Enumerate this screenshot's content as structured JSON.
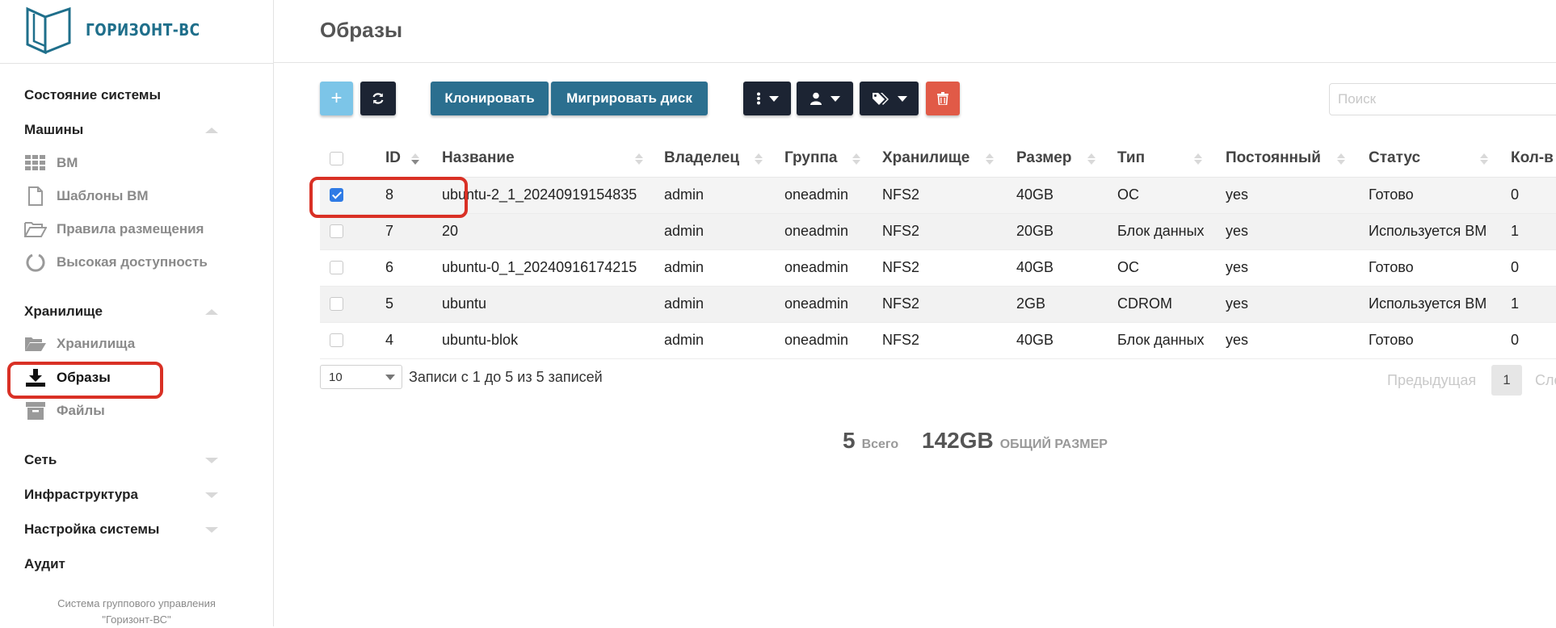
{
  "brand": {
    "name": "ГОРИЗОНТ-ВС"
  },
  "sidebar": {
    "system_state": "Состояние системы",
    "machines": {
      "label": "Машины",
      "items": [
        {
          "label": "ВМ",
          "icon": "grid-icon"
        },
        {
          "label": "Шаблоны ВМ",
          "icon": "file-icon"
        },
        {
          "label": "Правила размещения",
          "icon": "folder-open-icon"
        },
        {
          "label": "Высокая доступность",
          "icon": "circle-arc-icon"
        }
      ]
    },
    "storage": {
      "label": "Хранилище",
      "items": [
        {
          "label": "Хранилища",
          "icon": "folder-open-icon"
        },
        {
          "label": "Образы",
          "icon": "download-icon"
        },
        {
          "label": "Файлы",
          "icon": "archive-icon"
        }
      ]
    },
    "network": "Сеть",
    "infrastructure": "Инфраструктура",
    "settings": "Настройка системы",
    "audit": "Аудит",
    "footer_line1": "Система группового управления",
    "footer_line2": "\"Горизонт-ВС\""
  },
  "page": {
    "title": "Образы"
  },
  "toolbar": {
    "add_label": "+",
    "clone_label": "Клонировать",
    "migrate_label": "Мигрировать диск",
    "search_placeholder": "Поиск"
  },
  "table": {
    "columns": [
      "ID",
      "Название",
      "Владелец",
      "Группа",
      "Хранилище",
      "Размер",
      "Тип",
      "Постоянный",
      "Статус",
      "Кол-в"
    ],
    "rows": [
      {
        "checked": true,
        "id": "8",
        "name": "ubuntu-2_1_20240919154835",
        "owner": "admin",
        "group": "oneadmin",
        "datastore": "NFS2",
        "size": "40GB",
        "type": "ОС",
        "persistent": "yes",
        "status": "Готово",
        "count": "0"
      },
      {
        "checked": false,
        "id": "7",
        "name": "20",
        "owner": "admin",
        "group": "oneadmin",
        "datastore": "NFS2",
        "size": "20GB",
        "type": "Блок данных",
        "persistent": "yes",
        "status": "Используется ВМ",
        "count": "1"
      },
      {
        "checked": false,
        "id": "6",
        "name": "ubuntu-0_1_20240916174215",
        "owner": "admin",
        "group": "oneadmin",
        "datastore": "NFS2",
        "size": "40GB",
        "type": "ОС",
        "persistent": "yes",
        "status": "Готово",
        "count": "0"
      },
      {
        "checked": false,
        "id": "5",
        "name": "ubuntu",
        "owner": "admin",
        "group": "oneadmin",
        "datastore": "NFS2",
        "size": "2GB",
        "type": "CDROM",
        "persistent": "yes",
        "status": "Используется ВМ",
        "count": "1"
      },
      {
        "checked": false,
        "id": "4",
        "name": "ubuntu-blok",
        "owner": "admin",
        "group": "oneadmin",
        "datastore": "NFS2",
        "size": "40GB",
        "type": "Блок данных",
        "persistent": "yes",
        "status": "Готово",
        "count": "0"
      }
    ]
  },
  "pagination": {
    "page_size": "10",
    "info": "Записи с 1 до 5 из 5 записей",
    "prev": "Предыдущая",
    "current_page": "1",
    "next": "Сле"
  },
  "summary": {
    "total_count": "5",
    "total_label": "Всего",
    "total_size": "142GB",
    "size_label": "ОБЩИЙ РАЗМЕР"
  },
  "colors": {
    "accent": "#2b6f8f",
    "dark_button": "#1c2433",
    "add_button": "#7cc5e8",
    "delete_button": "#e15a47",
    "highlight": "#d93025"
  }
}
